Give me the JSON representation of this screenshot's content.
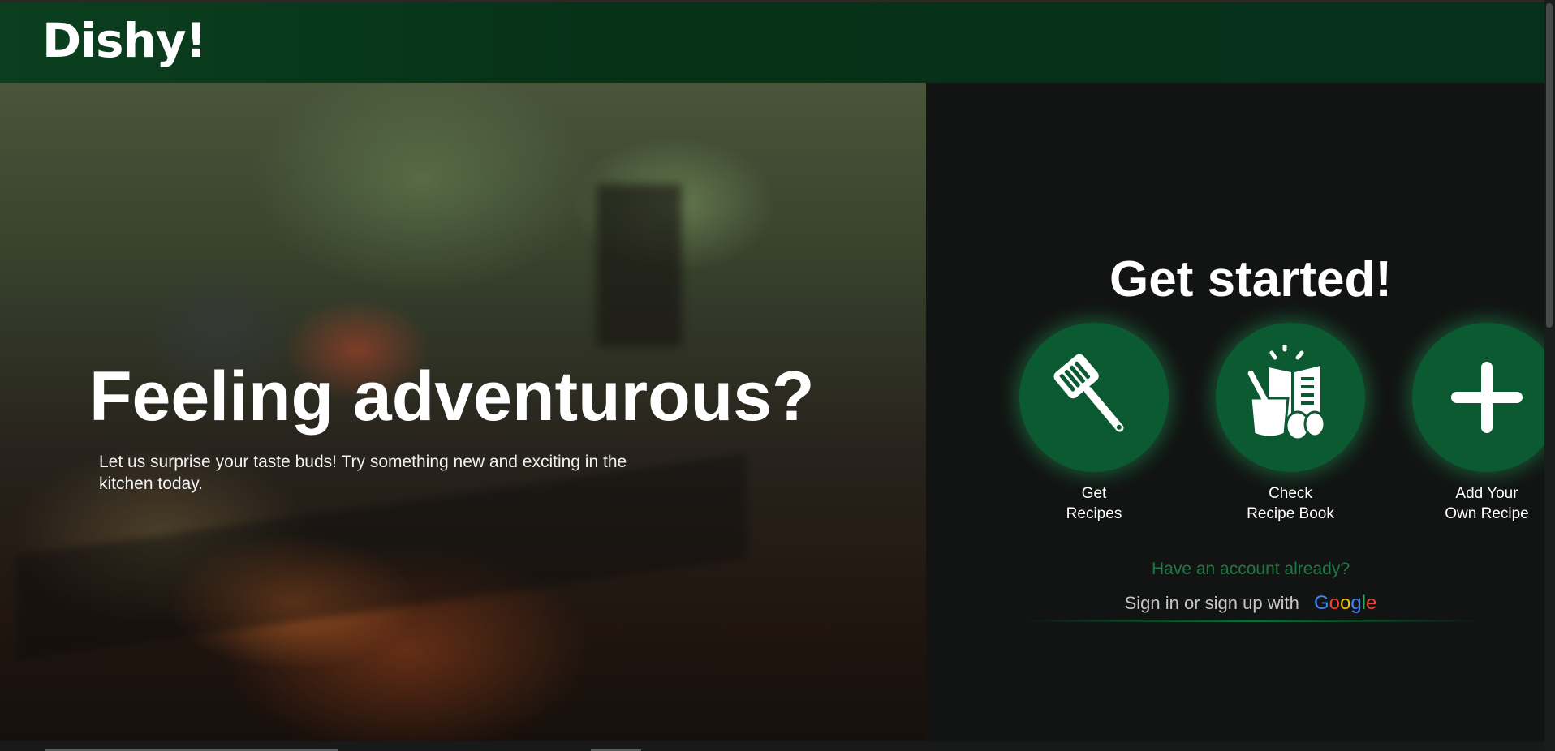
{
  "header": {
    "logo": "Dishy!"
  },
  "hero": {
    "title": "Feeling adventurous?",
    "subtitle": "Let us surprise your taste buds! Try something new and exciting in the kitchen today."
  },
  "panel": {
    "heading": "Get started!",
    "actions": [
      {
        "icon": "spatula-icon",
        "line1": "Get",
        "line2": "Recipes"
      },
      {
        "icon": "recipe-book-icon",
        "line1": "Check",
        "line2": "Recipe Book"
      },
      {
        "icon": "plus-icon",
        "line1": "Add Your",
        "line2": "Own Recipe"
      }
    ],
    "account_question": "Have an account already?",
    "signin_text": "Sign in or sign up with",
    "google": {
      "G": "G",
      "o1": "o",
      "o2": "o",
      "g": "g",
      "l": "l",
      "e": "e"
    }
  },
  "colors": {
    "header_bg": "#063218",
    "accent_green": "#0b5a32",
    "panel_bg": "#121413",
    "link_green": "#1e7a45",
    "google_blue": "#4285F4",
    "google_red": "#EA4335",
    "google_yellow": "#FBBC05",
    "google_green": "#34A853"
  }
}
